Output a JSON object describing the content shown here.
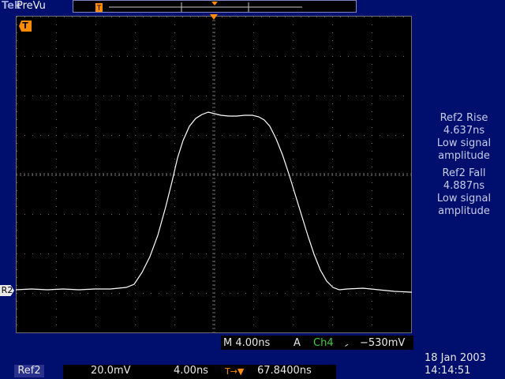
{
  "header": {
    "brand": "Tek",
    "mode": "PreVu",
    "record_marker": "T"
  },
  "trigger_marker": "T",
  "channel_marker": "R2",
  "waveform": {
    "color": "#ffffff",
    "trace": [
      [
        0,
        367
      ],
      [
        20,
        366
      ],
      [
        40,
        367
      ],
      [
        60,
        366
      ],
      [
        80,
        367
      ],
      [
        100,
        366
      ],
      [
        120,
        366
      ],
      [
        140,
        364
      ],
      [
        150,
        360
      ],
      [
        160,
        345
      ],
      [
        170,
        325
      ],
      [
        180,
        298
      ],
      [
        190,
        262
      ],
      [
        198,
        230
      ],
      [
        205,
        200
      ],
      [
        212,
        178
      ],
      [
        220,
        160
      ],
      [
        228,
        150
      ],
      [
        236,
        145
      ],
      [
        244,
        142
      ],
      [
        252,
        144
      ],
      [
        260,
        146
      ],
      [
        270,
        147
      ],
      [
        280,
        147
      ],
      [
        290,
        146
      ],
      [
        300,
        146
      ],
      [
        308,
        148
      ],
      [
        315,
        152
      ],
      [
        322,
        160
      ],
      [
        330,
        176
      ],
      [
        338,
        196
      ],
      [
        346,
        220
      ],
      [
        354,
        246
      ],
      [
        362,
        272
      ],
      [
        370,
        298
      ],
      [
        378,
        322
      ],
      [
        386,
        342
      ],
      [
        394,
        356
      ],
      [
        402,
        364
      ],
      [
        410,
        367
      ],
      [
        420,
        366
      ],
      [
        440,
        365
      ],
      [
        460,
        367
      ],
      [
        480,
        369
      ],
      [
        500,
        370
      ],
      [
        520,
        371
      ]
    ]
  },
  "measurements": [
    {
      "title": "Ref2 Rise",
      "value": "4.637ns",
      "note1": "Low signal",
      "note2": "amplitude"
    },
    {
      "title": "Ref2 Fall",
      "value": "4.887ns",
      "note1": "Low signal",
      "note2": "amplitude"
    }
  ],
  "status": {
    "horizontal": "M 4.00ns",
    "trigger_mode": "A",
    "trigger_source": "Ch4",
    "trigger_slope": "⹝",
    "trigger_level": "−530mV"
  },
  "bottom": {
    "ref_label": "Ref2",
    "vscale": "20.0mV",
    "hscale": "4.00ns",
    "position_icon": "T→▼",
    "position_value": "67.8400ns"
  },
  "datetime": {
    "date": "18 Jan  2003",
    "time": "14:14:51"
  },
  "colors": {
    "background": "#000e6e",
    "accent_orange": "#ff8c00",
    "ch4_green": "#3cd23c",
    "grid": "#6e6e6e"
  }
}
